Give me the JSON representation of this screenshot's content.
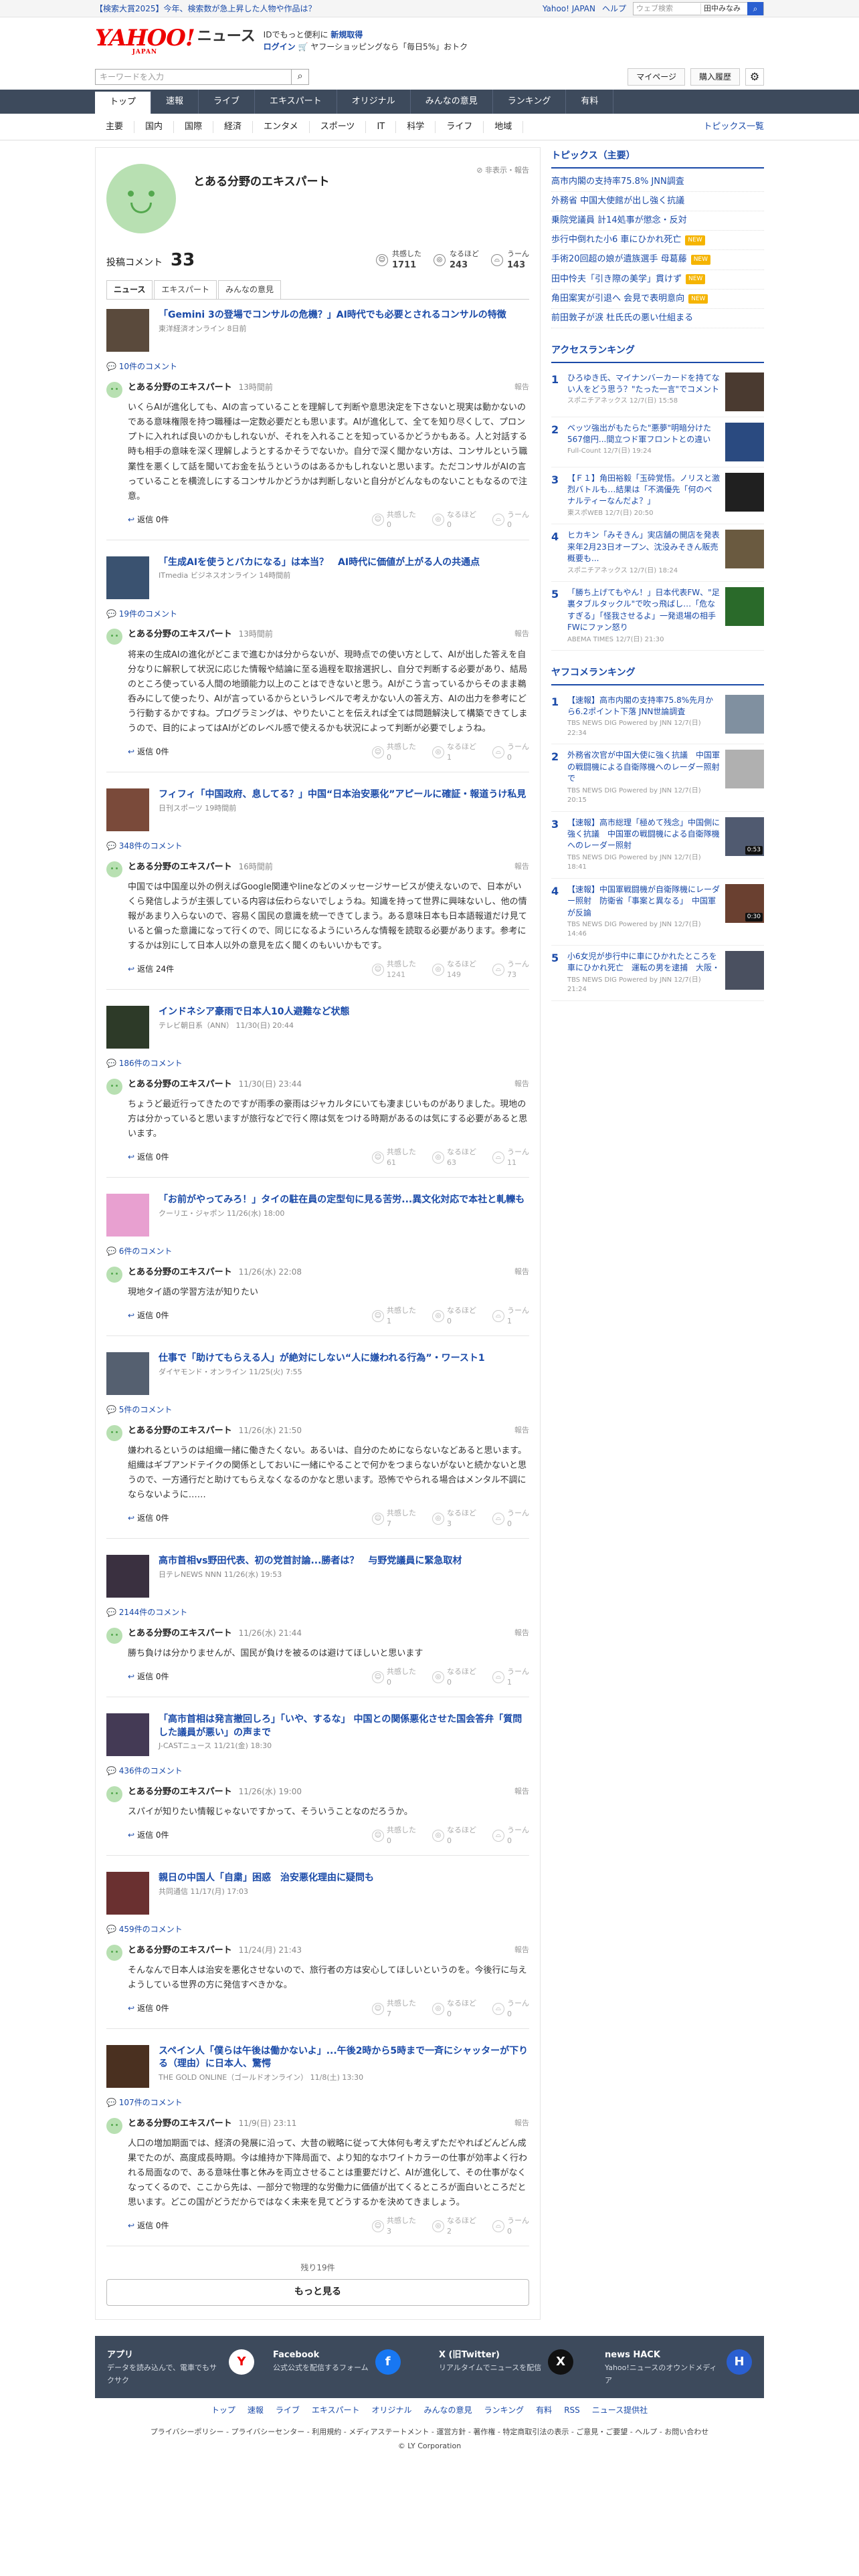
{
  "topbar": {
    "promo": "【検索大賞2025】今年、検索数が急上昇した人物や作品は？",
    "links": [
      "Yahoo! JAPAN",
      "ヘルプ"
    ],
    "search_placeholder": "ウェブ検索",
    "search_select": "田中みなみ"
  },
  "header": {
    "logo_text": "YAHOO!",
    "logo_sub": "JAPAN",
    "logo_news": "ニュース",
    "msg_line1a": "IDでもっと便利に",
    "msg_line1b": "新規取得",
    "msg_line2a": "ログイン",
    "msg_line2b": "ヤフーショッピングなら「毎日5%」おトク"
  },
  "searchrow": {
    "placeholder": "キーワードを入力",
    "mypage": "マイページ",
    "history": "購入履歴"
  },
  "nav1": [
    "トップ",
    "速報",
    "ライブ",
    "エキスパート",
    "オリジナル",
    "みんなの意見",
    "ランキング",
    "有料"
  ],
  "nav2": {
    "items": [
      "主要",
      "国内",
      "国際",
      "経済",
      "エンタメ",
      "スポーツ",
      "IT",
      "科学",
      "ライフ",
      "地域"
    ],
    "topics": "トピックス一覧"
  },
  "profile": {
    "name": "とある分野のエキスパート",
    "report": "非表示・報告",
    "comments_label": "投稿コメント",
    "comments_count": "33",
    "kyokan_label": "共感した",
    "kyokan": "1711",
    "naruhodo_label": "なるほど",
    "naruhodo": "243",
    "uun_label": "うーん",
    "uun": "143"
  },
  "tabs": [
    "ニュース",
    "エキスパート",
    "みんなの意見"
  ],
  "entries": [
    {
      "title": "「Gemini 3の登場でコンサルの危機？」AI時代でも必要とされるコンサルの特徴",
      "src": "東洋経済オンライン 8日前",
      "clink": "10件のコメント",
      "time": "13時間前",
      "text": "いくらAIが進化しても、AIの言っていることを理解して判断や意思決定を下さないと現実は動かないのである意味権限を持つ職種は一定数必要だとも思います。AIが進化して、全てを知り尽くして、プロンプトに入れれば良いのかもしれないが、それを入れることを知っているかどうかもある。人と対話する時も相手の意味を深く理解しようとするかそうでないか。自分で深く聞かない方は、コンサルという職業性を悪くして話を聞いてお金を払うというのはあるかもしれないと思います。ただコンサルがAIの言っていることを横流しにするコンサルかどうかは判断しないと自分がどんなものないこともなるので注意。",
      "reply": "返信 0件",
      "v": [
        "0",
        "0",
        "0"
      ]
    },
    {
      "title": "「生成AIを使うとバカになる」は本当？　AI時代に価値が上がる人の共通点",
      "src": "ITmedia ビジネスオンライン 14時間前",
      "clink": "19件のコメント",
      "time": "13時間前",
      "text": "将来の生成AIの進化がどこまで進むかは分からないが、現時点での使い方として、AIが出した答えを自分なりに解釈して状況に応じた情報や結論に至る過程を取捨選択し、自分で判断する必要があり、結局のところ使っている人間の地頭能力以上のことはできないと思う。AIがこう言っているからそのまま鵜呑みにして使ったり、AIが言っているからというレベルで考えかない人の答え方、AIの出力を参考にどう行動するかですね。プログラミングは、やりたいことを伝えれば全ては問題解決して構築できてしまうので、目的によってはAIがどのレベル感で使えるかも状況によって判断が必要でしょうね。",
      "reply": "返信 0件",
      "v": [
        "0",
        "1",
        "0"
      ]
    },
    {
      "title": "フィフィ「中国政府、息してる？」中国“日本治安悪化”アピールに確証・報道うけ私見",
      "src": "日刊スポーツ 19時間前",
      "clink": "348件のコメント",
      "time": "16時間前",
      "text": "中国では中国産以外の例えばGoogle関連やlineなどのメッセージサービスが使えないので、日本がいくら発信しようが主張している内容は伝わらないでしょうね。知識を持って世界に興味ないし、他の情報があまり入らないので、容易く国民の意識を統一できてしまう。ある意味日本も日本語報道だけ見ていると偏った意識になって行くので、同じになるようにいろんな情報を読取る必要があります。参考にするかは別にして日本人以外の意見を広く聞くのもいいかもです。",
      "reply": "返信 24件",
      "v": [
        "1241",
        "149",
        "73"
      ]
    },
    {
      "title": "インドネシア豪雨で日本人10人避難など状態",
      "src": "テレビ朝日系（ANN） 11/30(日) 20:44",
      "clink": "186件のコメント",
      "time": "11/30(日) 23:44",
      "text": "ちょうど最近行ってきたのですが雨季の豪雨はジャカルタにいても凄まじいものがありました。現地の方は分かっていると思いますが旅行などで行く際は気をつける時期があるのは気にする必要があると思います。",
      "reply": "返信 0件",
      "v": [
        "61",
        "63",
        "11"
      ]
    },
    {
      "title": "「お前がやってみろ！」タイの駐在員の定型句に見る苦労...異文化対応で本社と軋轢も",
      "src": "クーリエ・ジャポン 11/26(水) 18:00",
      "clink": "6件のコメント",
      "time": "11/26(水) 22:08",
      "text": "現地タイ語の学習方法が知りたい",
      "reply": "返信 0件",
      "v": [
        "1",
        "0",
        "1"
      ]
    },
    {
      "title": "仕事で「助けてもらえる人」が絶対にしない“人に嫌われる行為”・ワースト1",
      "src": "ダイヤモンド・オンライン 11/25(火) 7:55",
      "clink": "5件のコメント",
      "time": "11/26(水) 21:50",
      "text": "嫌われるというのは組織一緒に働きたくない。あるいは、自分のためにならないなどあると思います。組織はギブアンドテイクの関係としておいに一緒にやることで何かをつまらないがないと続かないと思うので、一方通行だと助けてもらえなくなるのかなと思います。恐怖でやられる場合はメンタル不調にならないように……",
      "reply": "返信 0件",
      "v": [
        "7",
        "3",
        "0"
      ]
    },
    {
      "title": "高市首相vs野田代表、初の党首討論...勝者は？　与野党議員に緊急取材",
      "src": "日テレNEWS NNN 11/26(水) 19:53",
      "clink": "2144件のコメント",
      "time": "11/26(水) 21:44",
      "text": "勝ち負けは分かりませんが、国民が負けを被るのは避けてほしいと思います",
      "reply": "返信 0件",
      "v": [
        "0",
        "0",
        "1"
      ]
    },
    {
      "title": "「高市首相は発言撤回しろ」「いや、するな」 中国との関係悪化させた国会答弁「質問した議員が悪い」の声まで",
      "src": "J-CASTニュース 11/21(金) 18:30",
      "clink": "436件のコメント",
      "time": "11/26(水) 19:00",
      "text": "スパイが知りたい情報じゃないですかって、そういうことなのだろうか。",
      "reply": "返信 0件",
      "v": [
        "0",
        "0",
        "0"
      ]
    },
    {
      "title": "親日の中国人「自粛」困惑　治安悪化理由に疑問も",
      "src": "共同通信 11/17(月) 17:03",
      "clink": "459件のコメント",
      "time": "11/24(月) 21:43",
      "text": "そんなんで日本人は治安を悪化させないので、旅行者の方は安心してほしいというのを。今後行に与えようしている世界の方に発信すべきかな。",
      "reply": "返信 0件",
      "v": [
        "7",
        "0",
        "0"
      ]
    },
    {
      "title": "スペイン人「僕らは午後は働かないよ」...午後2時から5時まで一斉にシャッターが下りる（理由）に日本人、驚愕",
      "src": "THE GOLD ONLINE（ゴールドオンライン） 11/8(土) 13:30",
      "clink": "107件のコメント",
      "time": "11/9(日) 23:11",
      "text": "人口の増加期面では、経済の発展に沿って、大昔の戦略に従って大体何も考えずただやればどんどん成果でたのが、高度成長時期。今は維持か下降局面で、より知的なホワイトカラーの仕事が効率よく行われる局面なので、ある意味仕事と休みを両立させることは重要だけど、AIが進化して、その仕事がなくなってくるので、ここから先は、一部分で物理的な労働力に価値が出てくるところが面白いところだと思います。どこの国がどうだからではなく未来を見てどうするかを決めてきましょう。",
      "reply": "返信 0件",
      "v": [
        "3",
        "2",
        "0"
      ]
    }
  ],
  "more_info": "残り19件",
  "more_button": "もっと見る",
  "side": {
    "topics_title": "トピックス（主要）",
    "topics": [
      {
        "t": "高市内閣の支持率75.8% JNN調査",
        "n": false
      },
      {
        "t": "外務省 中国大使館が出し強く抗議",
        "n": false
      },
      {
        "t": "乗院党議員 計14処事が懲念・反対",
        "n": false
      },
      {
        "t": "歩行中倒れた小6 車にひかれ死亡",
        "n": true
      },
      {
        "t": "手術20回超の娘が遺族選手 母葛藤",
        "n": true
      },
      {
        "t": "田中怜夫「引き際の美学」貫けず",
        "n": true
      },
      {
        "t": "角田案実が引退へ 会見で表明意向",
        "n": true
      },
      {
        "t": "前田敦子が涙 杜氏氏の悪い仕組まる",
        "n": false
      }
    ],
    "access_title": "アクセスランキング",
    "access": [
      {
        "t": "ひろゆき氏、マイナンバーカードを持てない人をどう思う？\"たった一言\"でコメント",
        "s": "スポニチアネックス 12/7(日) 15:58"
      },
      {
        "t": "ベッツ強出がもたらた\"悪夢\"明暗分けた567億円...間立つド軍フロントとの違い",
        "s": "Full-Count 12/7(日) 19:24"
      },
      {
        "t": "【Ｆ１】角田裕毅「玉砕覚悟。ノリスと激烈バトルも…結果は「不満優先「何のペナルティーなんだよ？」",
        "s": "東スポWEB 12/7(日) 20:50"
      },
      {
        "t": "ヒカキン「みそきん」実店舗の開店を発表　来年2月23日オープン、沈没みそきん販売概要も...",
        "s": "スポニチアネックス 12/7(日) 18:24"
      },
      {
        "t": "「勝ち上げてもやん！」日本代表FW、\"足裏タブルタックル\"で吹っ飛ばし…「危なすぎる」「怪我させるよ」一発退場の相手FWにファン怒り",
        "s": "ABEMA TIMES 12/7(日) 21:30"
      }
    ],
    "yahoo_title": "ヤフコメランキング",
    "yahoo": [
      {
        "t": "【速報】高市内閣の支持率75.8%先月から6.2ポイント下落 JNN世論調査",
        "s": "TBS NEWS DIG Powered by JNN 12/7(日) 22:34",
        "d": ""
      },
      {
        "t": "外務省次官が中国大使に強く抗議　中国軍の戦闘機による自衛隊機へのレーダー照射で",
        "s": "TBS NEWS DIG Powered by JNN 12/7(日) 20:15",
        "d": ""
      },
      {
        "t": "【速報】高市総理「極めて残念」中国側に強く抗議　中国軍の戦闘機による自衛隊機へのレーダー照射",
        "s": "TBS NEWS DIG Powered by JNN 12/7(日) 18:41",
        "d": "0:53"
      },
      {
        "t": "【速報】中国軍戦闘機が自衛隊機にレーダー照射　防衛省「事案と異なる」　中国軍が反論",
        "s": "TBS NEWS DIG Powered by JNN 12/7(日) 14:46",
        "d": "0:30"
      },
      {
        "t": "小6女児が歩行中に車にひかれたところを車にひかれ死亡　運転の男を逮捕　大阪・",
        "s": "TBS NEWS DIG Powered by JNN 12/7(日) 21:24",
        "d": ""
      }
    ]
  },
  "footer": {
    "cols": [
      {
        "t": "アプリ",
        "d": "データを読み込んで、電車でもサクサク",
        "ic": "Y"
      },
      {
        "t": "Facebook",
        "d": "公式公式を配信するフォーム",
        "ic": "f"
      },
      {
        "t": "X (旧Twitter)",
        "d": "リアルタイムでニュースを配信",
        "ic": "X"
      },
      {
        "t": "news HACK",
        "d": "Yahoo!ニュースのオウンドメディア",
        "ic": "H"
      }
    ],
    "links": [
      "トップ",
      "速報",
      "ライブ",
      "エキスパート",
      "オリジナル",
      "みんなの意見",
      "ランキング",
      "有料",
      "RSS",
      "ニュース提供社"
    ],
    "legal": "プライバシーポリシー - プライバシーセンター - 利用規約 - メディアステートメント - 運営方針 - 著作権 - 特定商取引法の表示 - ご意見・ご要望 - ヘルプ - お問い合わせ",
    "copy": "© LY Corporation"
  }
}
